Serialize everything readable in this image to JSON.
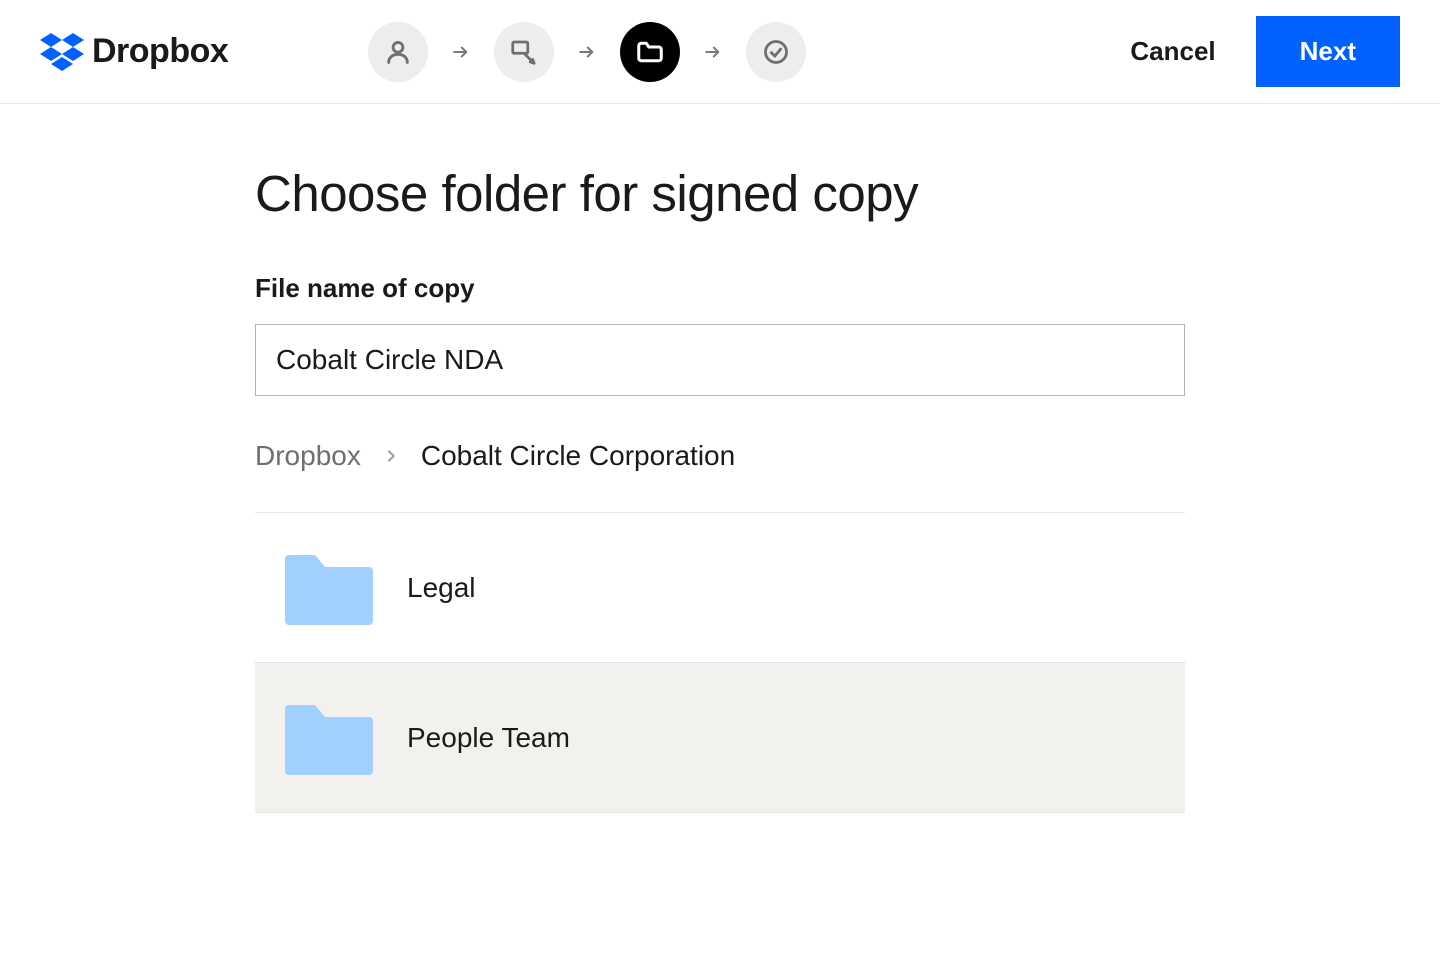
{
  "brand": {
    "name": "Dropbox",
    "logo_color": "#0061ff"
  },
  "header": {
    "cancel_label": "Cancel",
    "next_label": "Next"
  },
  "steps": [
    {
      "icon": "person-icon",
      "active": false
    },
    {
      "icon": "fields-icon",
      "active": false
    },
    {
      "icon": "folder-icon",
      "active": true
    },
    {
      "icon": "check-icon",
      "active": false
    }
  ],
  "main": {
    "title": "Choose folder for signed copy",
    "filename_label": "File name of copy",
    "filename_value": "Cobalt Circle NDA",
    "breadcrumb": {
      "root": "Dropbox",
      "current": "Cobalt Circle Corporation"
    },
    "folders": [
      {
        "name": "Legal",
        "selected": false
      },
      {
        "name": "People Team",
        "selected": true
      }
    ]
  },
  "colors": {
    "primary": "#0061ff",
    "folder": "#a1d0ff",
    "step_inactive_bg": "#ededed",
    "step_inactive_fg": "#6f6f6f",
    "row_selected_bg": "#f3f1ed"
  }
}
